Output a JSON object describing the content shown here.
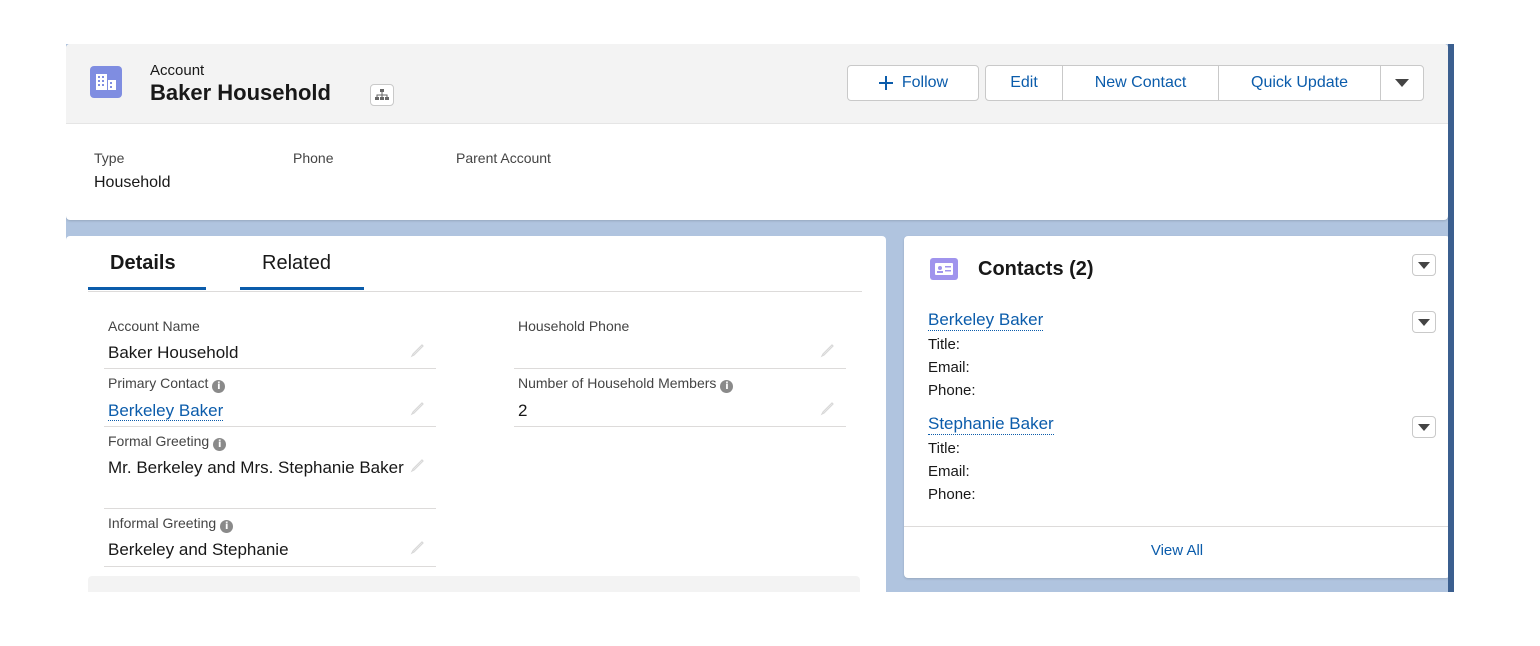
{
  "header": {
    "object_label": "Account",
    "record_name": "Baker Household",
    "icons": {
      "account": "account-icon",
      "hierarchy": "hierarchy-icon"
    },
    "buttons": {
      "follow": "Follow",
      "edit": "Edit",
      "new_contact": "New Contact",
      "quick_update": "Quick Update"
    },
    "highlights": [
      {
        "label": "Type",
        "value": "Household"
      },
      {
        "label": "Phone",
        "value": ""
      },
      {
        "label": "Parent Account",
        "value": ""
      }
    ]
  },
  "tabs": [
    {
      "label": "Details",
      "active": true
    },
    {
      "label": "Related",
      "active": false
    }
  ],
  "details": {
    "account_name": {
      "label": "Account Name",
      "value": "Baker Household"
    },
    "household_phone": {
      "label": "Household Phone",
      "value": ""
    },
    "primary_contact": {
      "label": "Primary Contact",
      "value": "Berkeley Baker"
    },
    "num_members": {
      "label": "Number of Household Members",
      "value": "2"
    },
    "formal_greeting": {
      "label": "Formal Greeting",
      "value": "Mr. Berkeley and Mrs. Stephanie Baker"
    },
    "informal_greeting": {
      "label": "Informal Greeting",
      "value": "Berkeley and Stephanie"
    }
  },
  "contacts": {
    "title": "Contacts (2)",
    "icon": "contact-card-icon",
    "items": [
      {
        "name": "Berkeley Baker",
        "title_label": "Title:",
        "email_label": "Email:",
        "phone_label": "Phone:"
      },
      {
        "name": "Stephanie Baker",
        "title_label": "Title:",
        "email_label": "Email:",
        "phone_label": "Phone:"
      }
    ],
    "view_all": "View All"
  },
  "colors": {
    "brand_link": "#0b5cab",
    "account_icon": "#7f8de1",
    "contact_icon": "#a094ed",
    "page_background": "#b0c4df"
  }
}
